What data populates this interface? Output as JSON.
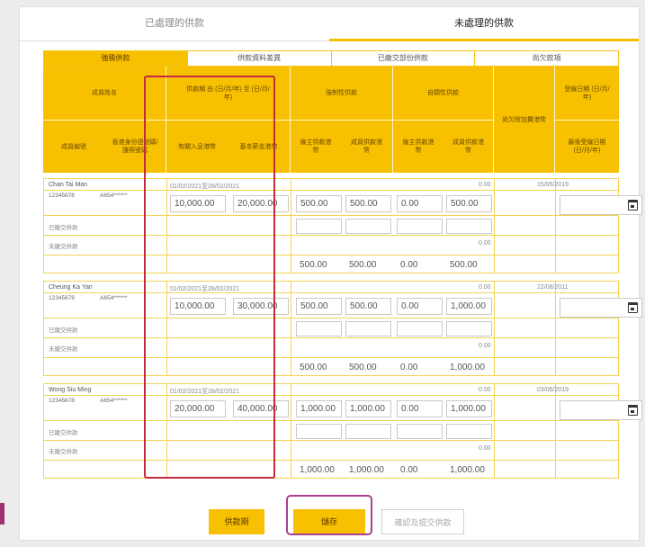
{
  "top_tabs": [
    {
      "label": "已處理的供款"
    },
    {
      "label": "未處理的供款"
    }
  ],
  "sub_tabs": [
    {
      "label": "強積供款"
    },
    {
      "label": "供款資料差異"
    },
    {
      "label": "已繳交部份供款"
    },
    {
      "label": "尚欠款項"
    }
  ],
  "headers": {
    "member_name": "成員姓名",
    "member_id": "成員編號",
    "hkid": "香港身份證號碼/護照號碼",
    "period": "供款期 由 (日/月/年) 至 (日/月/年)",
    "relevant_income": "有關入息港幣",
    "basic_salary": "基本薪金港幣",
    "mandatory": "強制性供款",
    "voluntary": "自願性供款",
    "er_contrib": "僱主供款港幣",
    "ee_contrib": "成員供款港幣",
    "surcharge": "尚欠附加費港幣",
    "employment_date": "受僱日期 (日/月/年)",
    "last_employment_date": "最後受僱日期 (日/月/年)"
  },
  "row_labels": {
    "paid": "已繳交供款",
    "unpaid": "未繳交供款"
  },
  "members": [
    {
      "name": "Chan Tai Man",
      "member_no": "12345678",
      "hkid": "A654******",
      "period": "01/02/2021至28/02/2021",
      "relevant_income": "10,000.00",
      "basic_salary": "20,000.00",
      "er_mandatory": "500.00",
      "ee_mandatory": "500.00",
      "er_voluntary": "0.00",
      "ee_voluntary": "500.00",
      "surcharge": "0.00",
      "surcharge_unpaid": "0.00",
      "employment_date": "15/05/2019",
      "unpaid_er_mandatory": "500.00",
      "unpaid_ee_mandatory": "500.00",
      "unpaid_er_voluntary": "0.00",
      "unpaid_ee_voluntary": "500.00"
    },
    {
      "name": "Cheung Ka Yan",
      "member_no": "12345678",
      "hkid": "A654******",
      "period": "01/02/2021至28/02/2021",
      "relevant_income": "10,000.00",
      "basic_salary": "30,000.00",
      "er_mandatory": "500.00",
      "ee_mandatory": "500.00",
      "er_voluntary": "0.00",
      "ee_voluntary": "1,000.00",
      "surcharge": "0.00",
      "surcharge_unpaid": "0.00",
      "employment_date": "22/08/2011",
      "unpaid_er_mandatory": "500.00",
      "unpaid_ee_mandatory": "500.00",
      "unpaid_er_voluntary": "0.00",
      "unpaid_ee_voluntary": "1,000.00"
    },
    {
      "name": "Wong Siu Ming",
      "member_no": "12345678",
      "hkid": "A654******",
      "period": "01/02/2021至28/02/2021",
      "relevant_income": "20,000.00",
      "basic_salary": "40,000.00",
      "er_mandatory": "1,000.00",
      "ee_mandatory": "1,000.00",
      "er_voluntary": "0.00",
      "ee_voluntary": "1,000.00",
      "surcharge": "0.00",
      "surcharge_unpaid": "0.00",
      "employment_date": "03/06/2019",
      "unpaid_er_mandatory": "1,000.00",
      "unpaid_ee_mandatory": "1,000.00",
      "unpaid_er_voluntary": "0.00",
      "unpaid_ee_voluntary": "1,000.00"
    }
  ],
  "buttons": {
    "period": "供款期",
    "save": "儲存",
    "submit": "確認及提交供款"
  },
  "colors": {
    "accent": "#f7c000",
    "highlight_red": "#c42a3d",
    "highlight_purple": "#a83f8f"
  },
  "icons": {
    "calendar": "calendar-icon"
  }
}
